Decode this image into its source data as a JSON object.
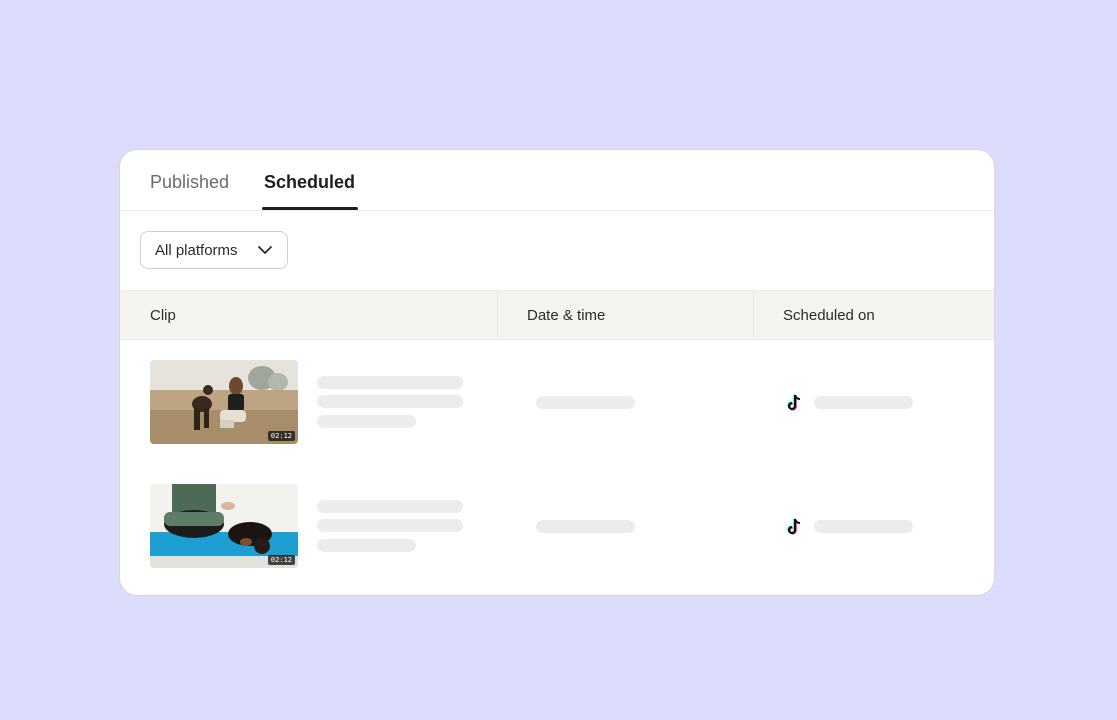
{
  "tabs": [
    {
      "label": "Published",
      "active": false
    },
    {
      "label": "Scheduled",
      "active": true
    }
  ],
  "filter": {
    "label": "All platforms",
    "icon": "chevron-down-icon"
  },
  "table": {
    "columns": [
      "Clip",
      "Date & time",
      "Scheduled on"
    ],
    "rows": [
      {
        "thumbnail_duration": "02:12",
        "platform_icon": "tiktok-icon"
      },
      {
        "thumbnail_duration": "02:12",
        "platform_icon": "tiktok-icon"
      }
    ]
  },
  "colors": {
    "background": "#dcdcfd",
    "card": "#ffffff",
    "header_bg": "#f4f4f1",
    "skeleton": "#ececea",
    "active_tab": "#1f1f1f"
  }
}
